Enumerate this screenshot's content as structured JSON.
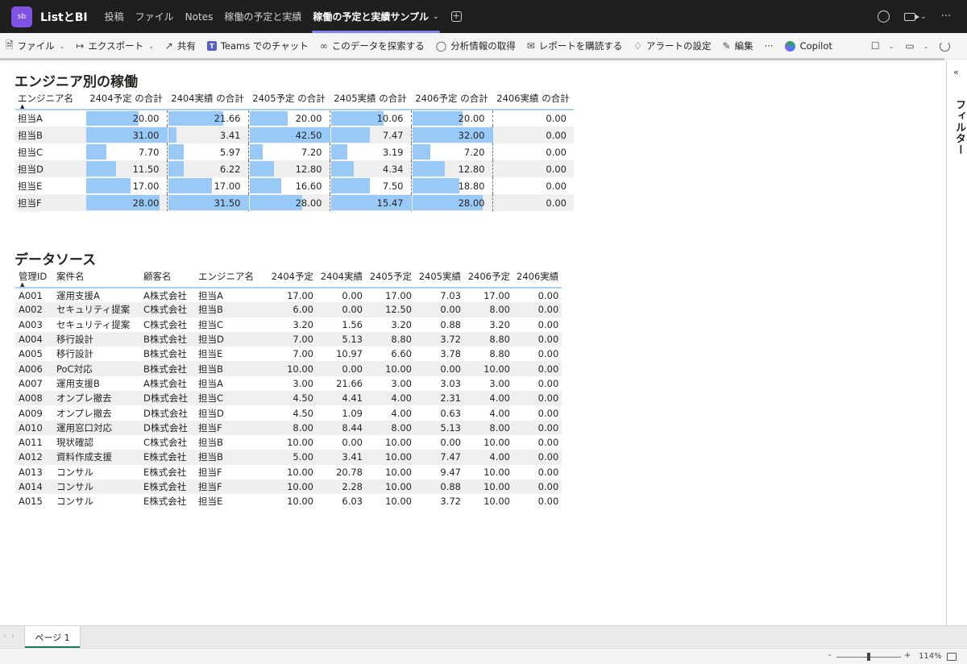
{
  "header": {
    "app_icon_text": "sb",
    "app_title": "ListとBI",
    "tabs": [
      {
        "label": "投稿"
      },
      {
        "label": "ファイル"
      },
      {
        "label": "Notes"
      },
      {
        "label": "稼働の予定と実績"
      },
      {
        "label": "稼働の予定と実績サンプル"
      }
    ],
    "more": "···"
  },
  "toolbar": {
    "file": "ファイル",
    "export": "エクスポート",
    "share": "共有",
    "teams_chat": "Teams でのチャット",
    "explore": "このデータを探索する",
    "insights": "分析情報の取得",
    "subscribe": "レポートを購読する",
    "alert": "アラートの設定",
    "edit": "編集",
    "more": "···",
    "copilot": "Copilot"
  },
  "filter_pane": {
    "label": "フィルター"
  },
  "matrix": {
    "title": "エンジニア別の稼働",
    "row_header": "エンジニア名",
    "columns": [
      "2404予定 の合計",
      "2404実績 の合計",
      "2405予定 の合計",
      "2405実績 の合計",
      "2406予定 の合計",
      "2406実績 の合計"
    ],
    "rows": [
      {
        "name": "担当A",
        "values": [
          "20.00",
          "21.66",
          "20.00",
          "10.06",
          "20.00",
          "0.00"
        ],
        "bars": [
          0.645,
          0.688,
          0.471,
          0.65,
          0.625,
          0
        ]
      },
      {
        "name": "担当B",
        "values": [
          "31.00",
          "3.41",
          "42.50",
          "7.47",
          "32.00",
          "0.00"
        ],
        "bars": [
          1.0,
          0.108,
          1.0,
          0.483,
          1.0,
          0
        ]
      },
      {
        "name": "担当C",
        "values": [
          "7.70",
          "5.97",
          "7.20",
          "3.19",
          "7.20",
          "0.00"
        ],
        "bars": [
          0.248,
          0.19,
          0.169,
          0.206,
          0.225,
          0
        ]
      },
      {
        "name": "担当D",
        "values": [
          "11.50",
          "6.22",
          "12.80",
          "4.34",
          "12.80",
          "0.00"
        ],
        "bars": [
          0.371,
          0.197,
          0.301,
          0.281,
          0.4,
          0
        ]
      },
      {
        "name": "担当E",
        "values": [
          "17.00",
          "17.00",
          "16.60",
          "7.50",
          "18.80",
          "0.00"
        ],
        "bars": [
          0.548,
          0.54,
          0.391,
          0.485,
          0.588,
          0
        ]
      },
      {
        "name": "担当F",
        "values": [
          "28.00",
          "31.50",
          "28.00",
          "15.47",
          "28.00",
          "0.00"
        ],
        "bars": [
          0.903,
          1.0,
          0.659,
          1.0,
          0.875,
          0
        ]
      }
    ]
  },
  "datasource": {
    "title": "データソース",
    "columns": [
      "管理ID",
      "案件名",
      "顧客名",
      "エンジニア名",
      "2404予定",
      "2404実績",
      "2405予定",
      "2405実績",
      "2406予定",
      "2406実績"
    ],
    "rows": [
      [
        "A001",
        "運用支援A",
        "A株式会社",
        "担当A",
        "17.00",
        "0.00",
        "17.00",
        "7.03",
        "17.00",
        "0.00"
      ],
      [
        "A002",
        "セキュリティ提案",
        "C株式会社",
        "担当B",
        "6.00",
        "0.00",
        "12.50",
        "0.00",
        "8.00",
        "0.00"
      ],
      [
        "A003",
        "セキュリティ提案",
        "C株式会社",
        "担当C",
        "3.20",
        "1.56",
        "3.20",
        "0.88",
        "3.20",
        "0.00"
      ],
      [
        "A004",
        "移行設計",
        "B株式会社",
        "担当D",
        "7.00",
        "5.13",
        "8.80",
        "3.72",
        "8.80",
        "0.00"
      ],
      [
        "A005",
        "移行設計",
        "B株式会社",
        "担当E",
        "7.00",
        "10.97",
        "6.60",
        "3.78",
        "8.80",
        "0.00"
      ],
      [
        "A006",
        "PoC対応",
        "B株式会社",
        "担当B",
        "10.00",
        "0.00",
        "10.00",
        "0.00",
        "10.00",
        "0.00"
      ],
      [
        "A007",
        "運用支援B",
        "A株式会社",
        "担当A",
        "3.00",
        "21.66",
        "3.00",
        "3.03",
        "3.00",
        "0.00"
      ],
      [
        "A008",
        "オンプレ撤去",
        "D株式会社",
        "担当C",
        "4.50",
        "4.41",
        "4.00",
        "2.31",
        "4.00",
        "0.00"
      ],
      [
        "A009",
        "オンプレ撤去",
        "D株式会社",
        "担当D",
        "4.50",
        "1.09",
        "4.00",
        "0.63",
        "4.00",
        "0.00"
      ],
      [
        "A010",
        "運用窓口対応",
        "D株式会社",
        "担当F",
        "8.00",
        "8.44",
        "8.00",
        "5.13",
        "8.00",
        "0.00"
      ],
      [
        "A011",
        "現状確認",
        "C株式会社",
        "担当B",
        "10.00",
        "0.00",
        "10.00",
        "0.00",
        "10.00",
        "0.00"
      ],
      [
        "A012",
        "資料作成支援",
        "E株式会社",
        "担当B",
        "5.00",
        "3.41",
        "10.00",
        "7.47",
        "4.00",
        "0.00"
      ],
      [
        "A013",
        "コンサル",
        "E株式会社",
        "担当F",
        "10.00",
        "20.78",
        "10.00",
        "9.47",
        "10.00",
        "0.00"
      ],
      [
        "A014",
        "コンサル",
        "E株式会社",
        "担当F",
        "10.00",
        "2.28",
        "10.00",
        "0.88",
        "10.00",
        "0.00"
      ],
      [
        "A015",
        "コンサル",
        "E株式会社",
        "担当E",
        "10.00",
        "6.03",
        "10.00",
        "3.72",
        "10.00",
        "0.00"
      ]
    ]
  },
  "pages": {
    "current_tab": "ページ 1"
  },
  "status": {
    "zoom": "114%",
    "zoom_level": 0.5
  },
  "colors": {
    "bar": "#99caf7",
    "teams_accent": "#7f85f5",
    "app_icon": "#7f53e6",
    "page_tab_accent": "#117865"
  }
}
